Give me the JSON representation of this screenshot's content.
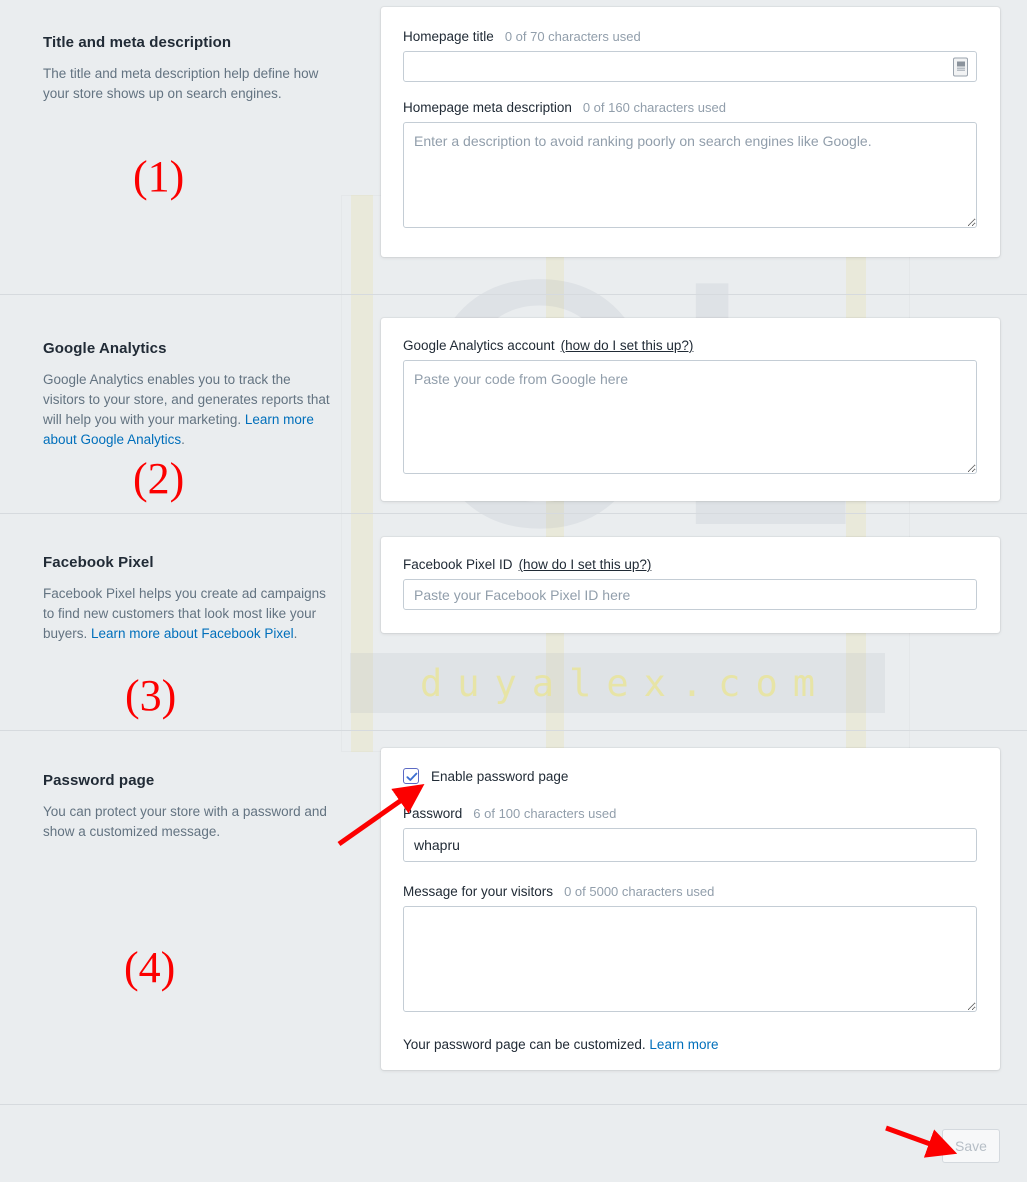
{
  "sections": [
    {
      "id": "title-meta",
      "title": "Title and meta description",
      "description": "The title and meta description help define how your store shows up on search engines.",
      "marker": "(1)",
      "fields": {
        "homepage_title_label": "Homepage title",
        "homepage_title_counter": "0 of 70 characters used",
        "homepage_title_value": "",
        "homepage_title_placeholder": "",
        "meta_description_label": "Homepage meta description",
        "meta_description_counter": "0 of 160 characters used",
        "meta_description_value": "",
        "meta_description_placeholder": "Enter a description to avoid ranking poorly on search engines like Google."
      }
    },
    {
      "id": "google-analytics",
      "title": "Google Analytics",
      "description_pre": "Google Analytics enables you to track the visitors to your store, and generates reports that will help you with your marketing. ",
      "description_link": "Learn more about Google Analytics",
      "description_post": ".",
      "marker": "(2)",
      "fields": {
        "account_label": "Google Analytics account",
        "account_help_link": "(how do I set this up?)",
        "account_value": "",
        "account_placeholder": "Paste your code from Google here"
      }
    },
    {
      "id": "facebook-pixel",
      "title": "Facebook Pixel",
      "description_pre": "Facebook Pixel helps you create ad campaigns to find new customers that look most like your buyers. ",
      "description_link": "Learn more about Facebook Pixel",
      "description_post": ".",
      "marker": "(3)",
      "fields": {
        "pixel_label": "Facebook Pixel ID",
        "pixel_help_link": "(how do I set this up?)",
        "pixel_value": "",
        "pixel_placeholder": "Paste your Facebook Pixel ID here"
      }
    },
    {
      "id": "password-page",
      "title": "Password page",
      "description": "You can protect your store with a password and show a customized message.",
      "marker": "(4)",
      "fields": {
        "enable_checkbox_label": "Enable password page",
        "enable_checkbox_checked": true,
        "password_label": "Password",
        "password_counter": "6 of 100 characters used",
        "password_value": "whapru",
        "message_label": "Message for your visitors",
        "message_counter": "0 of 5000 characters used",
        "message_value": "",
        "note_text": "Your password page can be customized.",
        "note_link": "Learn more"
      }
    }
  ],
  "footer": {
    "save_label": "Save",
    "save_disabled": true
  },
  "watermark": {
    "logo_text": "OL",
    "domain_text": "duyalex.com"
  },
  "colors": {
    "page_background": "#eaedef",
    "card_background": "#ffffff",
    "heading_text": "#212b36",
    "body_text": "#637381",
    "link_blue": "#006fbb",
    "checkbox_blue": "#3d6fd1",
    "annotation_red": "#fc0000",
    "border_grey": "#c4cdd5",
    "divider_grey": "#d6dade"
  },
  "annotations": {
    "arrow_to_checkbox": "red-arrow",
    "arrow_to_save": "red-arrow"
  }
}
